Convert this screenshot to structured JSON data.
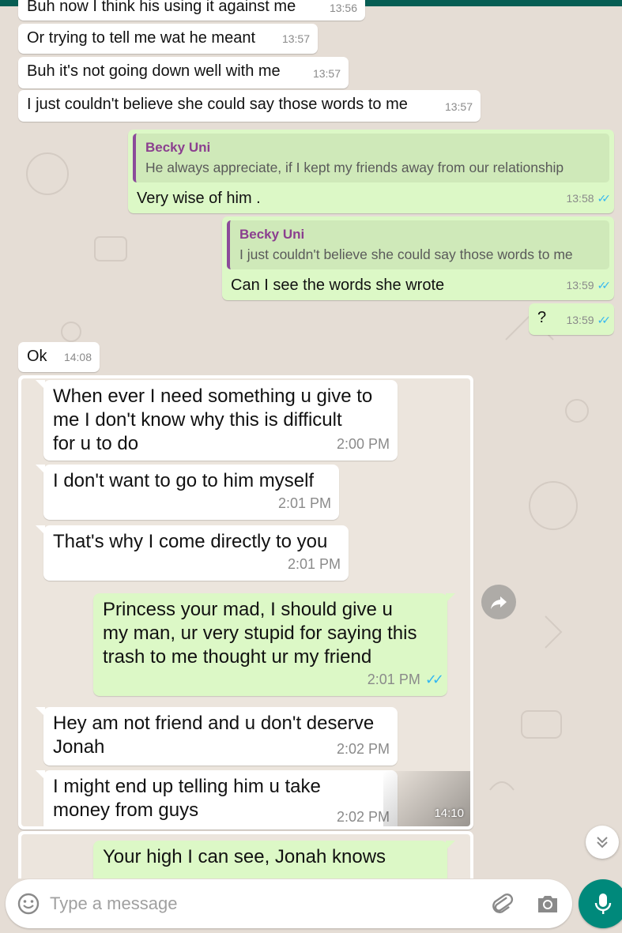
{
  "messages": [
    {
      "text": "Buh now I think his using it against me",
      "time": "13:56"
    },
    {
      "text": "Or trying to tell me wat he meant",
      "time": "13:57"
    },
    {
      "text": "Buh it's not going down well with me",
      "time": "13:57"
    },
    {
      "text": "I just couldn't believe she could say those words to me",
      "time": "13:57"
    },
    {
      "quote_author": "Becky Uni",
      "quote_text": "He always appreciate, if I kept my friends away from our relationship",
      "text": "Very wise of him .",
      "time": "13:58"
    },
    {
      "quote_author": "Becky Uni",
      "quote_text": "I just couldn't believe she could say those words to me",
      "text": "Can I see the words she wrote",
      "time": "13:59"
    },
    {
      "text": "?",
      "time": "13:59"
    },
    {
      "text": "Ok",
      "time": "14:08"
    }
  ],
  "image_message": {
    "time": "14:10",
    "screenshot_bubbles": [
      {
        "text": "When ever I need something u give to\nme I don't know why this is difficult\nfor u to do",
        "time": "2:00 PM"
      },
      {
        "text": "I don't want to go to him myself",
        "time": "2:01 PM"
      },
      {
        "text": "That's why I come directly to you",
        "time": "2:01 PM"
      },
      {
        "text": "Princess your mad, I should give u\nmy man, ur very stupid for saying this\ntrash to me thought ur my friend",
        "time": "2:01 PM"
      },
      {
        "text": "Hey am not friend and u don't deserve\nJonah",
        "time": "2:02 PM"
      },
      {
        "text": "I might end up telling him u take\nmoney from guys",
        "time": "2:02 PM"
      }
    ]
  },
  "image_message_2": {
    "screenshot_bubbles": [
      {
        "text": "Your high I can see, Jonah knows"
      }
    ]
  },
  "input": {
    "placeholder": "Type a message"
  },
  "colors": {
    "header": "#075e54",
    "outgoing": "#dcf8c6",
    "incoming": "#ffffff",
    "ticks": "#34b7f1",
    "mic": "#00897b"
  },
  "icons": [
    "forward-icon",
    "double-chevron-down-icon",
    "emoji-icon",
    "paperclip-icon",
    "camera-icon",
    "mic-icon"
  ]
}
